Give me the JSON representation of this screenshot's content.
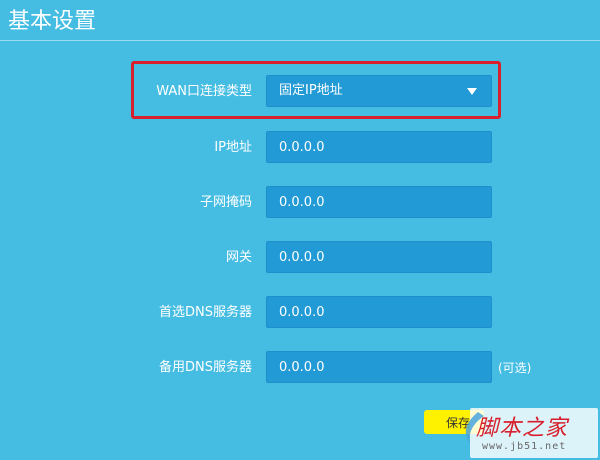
{
  "page": {
    "title": "基本设置"
  },
  "form": {
    "wan_type": {
      "label": "WAN口连接类型",
      "value": "固定IP地址"
    },
    "ip": {
      "label": "IP地址",
      "value": "0.0.0.0"
    },
    "subnet": {
      "label": "子网掩码",
      "value": "0.0.0.0"
    },
    "gateway": {
      "label": "网关",
      "value": "0.0.0.0"
    },
    "dns_primary": {
      "label": "首选DNS服务器",
      "value": "0.0.0.0"
    },
    "dns_secondary": {
      "label": "备用DNS服务器",
      "value": "0.0.0.0",
      "note": "(可选)"
    }
  },
  "actions": {
    "save_label": "保存"
  },
  "watermark": {
    "main": "脚本之家",
    "sub": "www.jb51.net"
  },
  "colors": {
    "background": "#45bde2",
    "field": "#229ad6",
    "highlight": "#d81f2b",
    "save_button": "#fff200"
  },
  "icons": {
    "select_caret": "chevron-down-icon"
  }
}
